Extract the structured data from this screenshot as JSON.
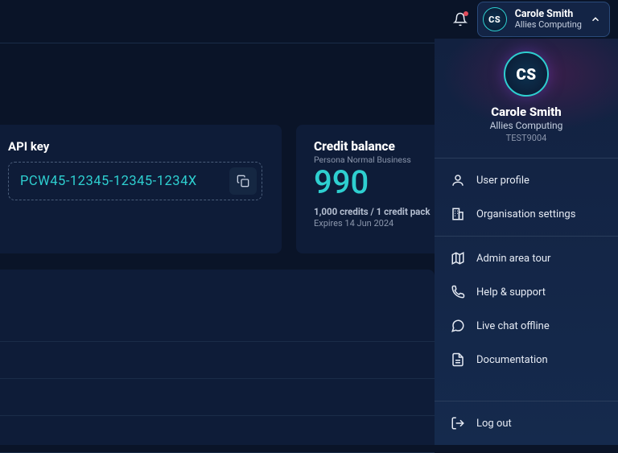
{
  "header": {
    "user_name": "Carole Smith",
    "user_org": "Allies Computing",
    "avatar_initials": "CS"
  },
  "api_card": {
    "title": "API key",
    "value": "PCW45-12345-12345-1234X"
  },
  "credit_card": {
    "title": "Credit balance",
    "persona": "Persona Normal Business",
    "balance": "990",
    "detail": "1,000 credits / 1 credit pack",
    "expires": "Expires 14 Jun 2024"
  },
  "menu_user": {
    "avatar_initials": "CS",
    "name": "Carole Smith",
    "org": "Allies Computing",
    "code": "TEST9004"
  },
  "menu": {
    "group1": [
      {
        "label": "User profile"
      },
      {
        "label": "Organisation settings"
      }
    ],
    "group2": [
      {
        "label": "Admin area tour"
      },
      {
        "label": "Help & support"
      },
      {
        "label": "Live chat offline"
      },
      {
        "label": "Documentation"
      }
    ],
    "logout": "Log out"
  }
}
